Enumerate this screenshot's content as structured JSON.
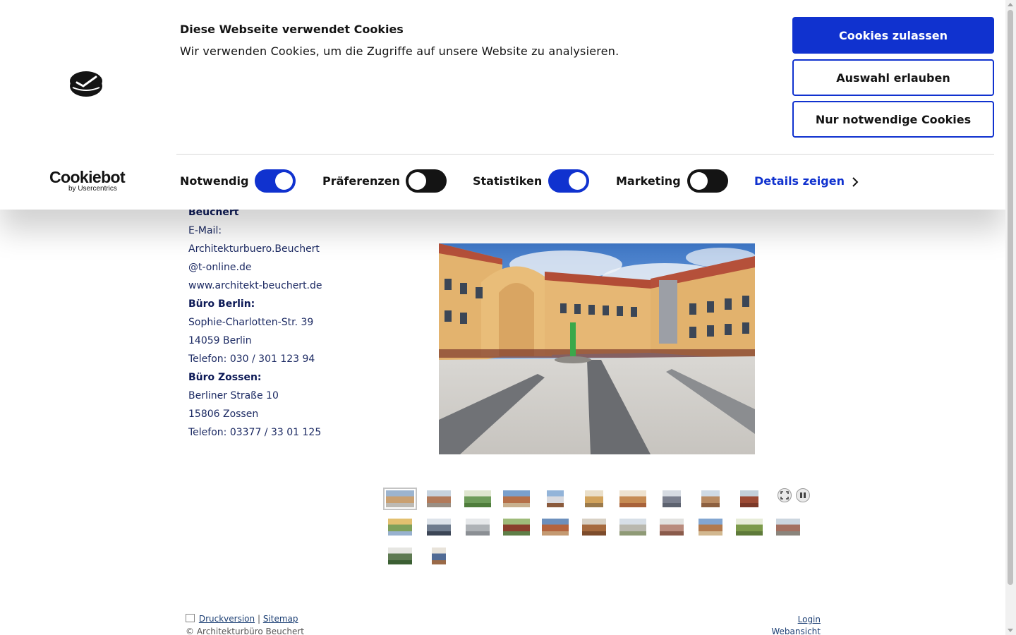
{
  "contact": {
    "name_tail": "Beuchert",
    "email_label": "E-Mail:",
    "email_line1": "Architekturbuero.Beuchert",
    "email_line2": "@t-online.de",
    "website": "www.architekt-beuchert.de",
    "office_berlin": {
      "heading": "Büro Berlin:",
      "street": "Sophie-Charlotten-Str. 39",
      "city": "14059 Berlin",
      "phone": "Telefon: 030 / 301 123 94"
    },
    "office_zossen": {
      "heading": "Büro Zossen:",
      "street": "Berliner Straße 10",
      "city": "15806 Zossen",
      "phone": "Telefon: 03377 / 33 01 125"
    }
  },
  "gallery": {
    "thumbnail_count": 23,
    "active_index": 0,
    "controls": [
      "fullscreen-icon",
      "pause-icon"
    ]
  },
  "footer": {
    "print_label": "Druckversion",
    "separator": "|",
    "sitemap_label": "Sitemap",
    "copyright": "© Architekturbüro Beuchert",
    "login_label": "Login",
    "webview_label": "Webansicht"
  },
  "cookie_banner": {
    "title": "Diese Webseite verwendet Cookies",
    "description": "Wir verwenden Cookies, um die Zugriffe auf unsere Website zu analysieren.",
    "buttons": {
      "allow_all": "Cookies zulassen",
      "allow_selection": "Auswahl erlauben",
      "necessary_only": "Nur notwendige Cookies"
    },
    "brand": "Cookiebot",
    "brand_sub": "by Usercentrics",
    "toggles": [
      {
        "label": "Notwendig",
        "on": true
      },
      {
        "label": "Präferenzen",
        "on": false
      },
      {
        "label": "Statistiken",
        "on": true
      },
      {
        "label": "Marketing",
        "on": false
      }
    ],
    "details_label": "Details zeigen",
    "colors": {
      "accent": "#1032cf",
      "toggle_off": "#141414"
    }
  }
}
